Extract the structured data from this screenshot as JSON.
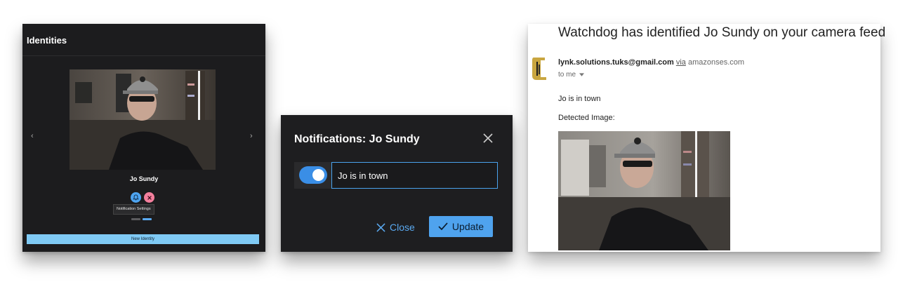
{
  "identities_panel": {
    "title": "Identities",
    "person_name": "Jo Sundy",
    "tooltip": "Notification Settings",
    "new_identity_label": "New Identity",
    "prev_arrow": "‹",
    "next_arrow": "›",
    "carousel_page": 2,
    "carousel_total": 2
  },
  "notifications_dialog": {
    "title": "Notifications: Jo Sundy",
    "message_value": "Jo is in town",
    "toggle_on": true,
    "close_label": "Close",
    "update_label": "Update"
  },
  "email": {
    "subject": "Watchdog has identified Jo Sundy on your camera feed",
    "sender": "lynk.solutions.tuks@gmail.com",
    "via_label": "via",
    "via_domain": "amazonses.com",
    "to_label": "to me",
    "body_line": "Jo is in town",
    "detected_label": "Detected Image:"
  },
  "colors": {
    "dark_bg": "#1c1c1e",
    "accent_blue": "#4fa3ee",
    "light_blue": "#7fcaf5",
    "delete_pink": "#f47f9d"
  },
  "icons": [
    "chevron-left-icon",
    "chevron-right-icon",
    "bell-icon",
    "delete-x-icon",
    "close-icon",
    "check-icon",
    "dropdown-caret-icon",
    "logo-icon"
  ]
}
